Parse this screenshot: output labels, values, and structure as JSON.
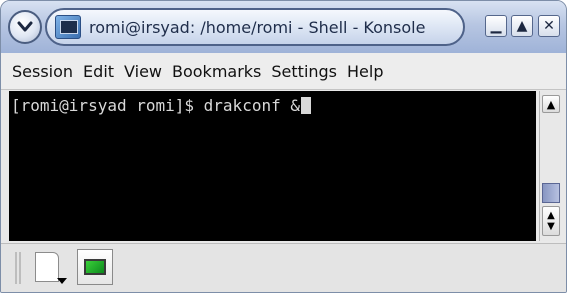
{
  "window": {
    "title": "romi@irsyad: /home/romi - Shell - Konsole",
    "buttons": {
      "minimize": "▁",
      "maximize": "▲",
      "close": "✕"
    }
  },
  "menubar": {
    "items": [
      "Session",
      "Edit",
      "View",
      "Bookmarks",
      "Settings",
      "Help"
    ]
  },
  "terminal": {
    "line": "[romi@irsyad romi]$ drakconf &"
  },
  "scrollbar": {
    "up_arrow": "▲",
    "down_arrows": [
      "▲",
      "▼"
    ]
  },
  "tabbar": {
    "icons": [
      "new-session-icon",
      "konsole-session-icon"
    ]
  },
  "colors": {
    "title_gradient_top": "#d8e2f2",
    "title_gradient_bottom": "#9fb3d8",
    "terminal_bg": "#000000",
    "terminal_fg": "#d8d8d8",
    "scroll_handle": "#8896c2",
    "session_screen": "#1fb52c"
  }
}
